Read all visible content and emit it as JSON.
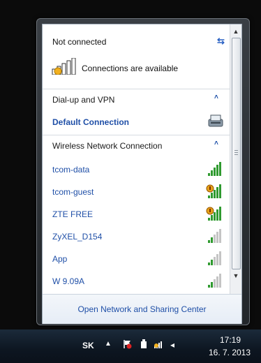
{
  "header": {
    "status": "Not connected",
    "availability": "Connections are available"
  },
  "sections": {
    "dialup": {
      "label": "Dial-up and VPN"
    },
    "wireless": {
      "label": "Wireless Network Connection"
    }
  },
  "dialup_items": [
    {
      "name": "Default Connection"
    }
  ],
  "networks": [
    {
      "name": "tcom-data",
      "signal": 5,
      "secured": false
    },
    {
      "name": "tcom-guest",
      "signal": 5,
      "secured": true
    },
    {
      "name": "ZTE FREE",
      "signal": 5,
      "secured": true
    },
    {
      "name": "ZyXEL_D154",
      "signal": 2,
      "secured": false
    },
    {
      "name": "App",
      "signal": 2,
      "secured": false
    },
    {
      "name": "W 9.09A",
      "signal": 2,
      "secured": false
    }
  ],
  "footer": {
    "link": "Open Network and Sharing Center"
  },
  "taskbar": {
    "language": "SK",
    "time": "17:19",
    "date": "16. 7. 2013"
  },
  "colors": {
    "link": "#1f4fa7",
    "signal_active": "#2f9a2f",
    "signal_inactive": "#c4c4c4"
  }
}
